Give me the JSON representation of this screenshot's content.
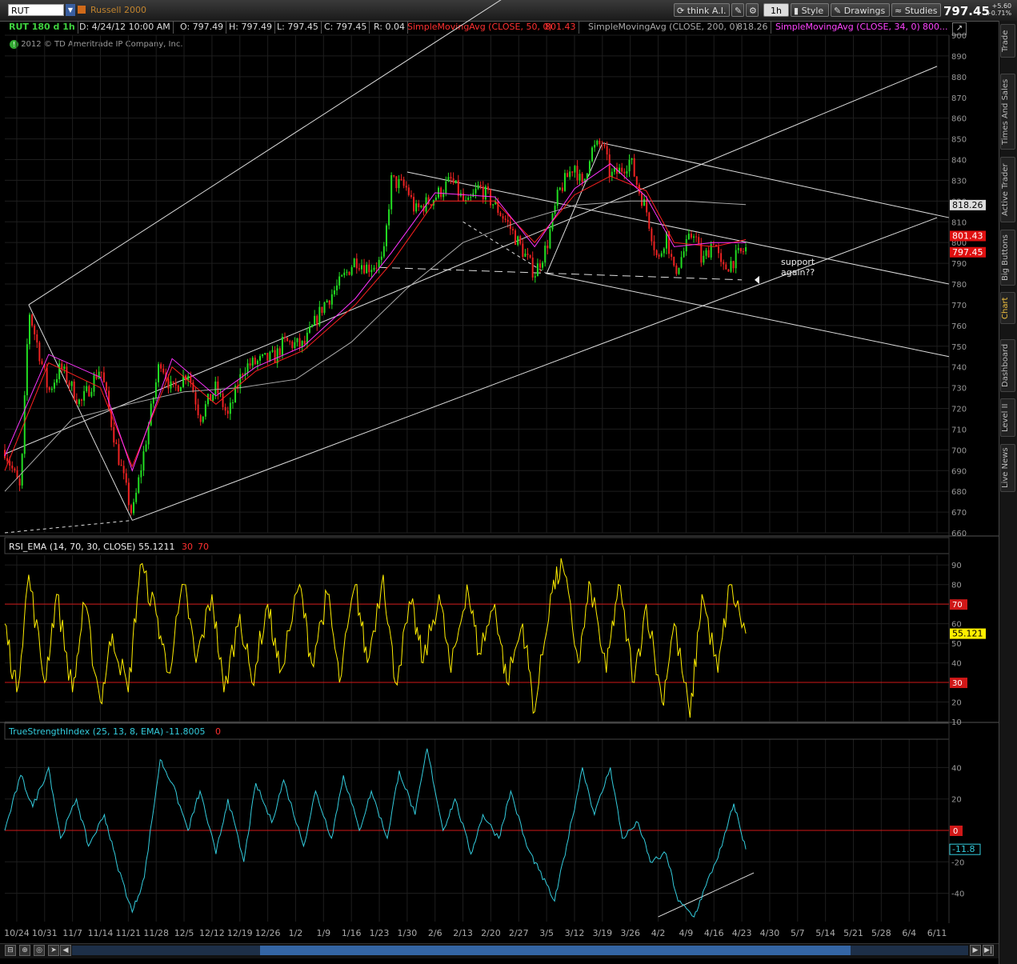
{
  "toolbar": {
    "symbol": "RUT",
    "description": "Russell 2000",
    "think_label": "think A.I.",
    "timeframe": "1h",
    "style_label": "Style",
    "drawings_label": "Drawings",
    "studies_label": "Studies",
    "last_price": "797.45",
    "change": "+5.60",
    "change_pct": "+0.71%"
  },
  "header": {
    "symbol_period": "RUT 180 d 1h",
    "date": "D: 4/24/12 10:00 AM",
    "open": "O: 797.49",
    "high": "H: 797.49",
    "low": "L: 797.45",
    "close": "C: 797.45",
    "range": "R: 0.04",
    "sma50_label": "SimpleMovingAvg (CLOSE, 50, 0)",
    "sma50_value": "801.43",
    "sma200_label": "SimpleMovingAvg (CLOSE, 200, 0)",
    "sma200_value": "818.26",
    "sma34_label": "SimpleMovingAvg (CLOSE, 34, 0)",
    "sma34_value": "800..."
  },
  "watermark": "2012 © TD Ameritrade IP Company, Inc.",
  "annotation": [
    "support",
    "again??"
  ],
  "rsi_header": {
    "label": "RSI_EMA (14, 70, 30, CLOSE)",
    "value": "55.1211",
    "low": "30",
    "high": "70"
  },
  "tsi_header": {
    "label": "TrueStrengthIndex (25, 13, 8, EMA)",
    "value": "-11.8005",
    "zero": "0"
  },
  "side_tabs": [
    "Trade",
    "Times And Sales",
    "Active Trader",
    "Big Buttons",
    "Chart",
    "Dashboard",
    "Level II",
    "Live News"
  ],
  "colors": {
    "up": "#22dd22",
    "down": "#ee2222",
    "sma50": "#ff2020",
    "sma34": "#ff33ff",
    "sma200": "#aaaaaa",
    "rsi": "#ffee00",
    "tsi": "#33ccdd",
    "grid": "#1e1e1e",
    "trend": "#dddddd"
  },
  "chart_data": [
    {
      "type": "line",
      "panel": "price",
      "title": "RUT 180 d 1h",
      "ylim": [
        660,
        900
      ],
      "y_ticks": [
        660,
        670,
        680,
        690,
        700,
        710,
        720,
        730,
        740,
        750,
        760,
        770,
        780,
        790,
        800,
        810,
        820,
        830,
        840,
        850,
        860,
        870,
        880,
        890,
        900
      ],
      "x_tick_labels": [
        "10/24",
        "10/31",
        "11/7",
        "11/14",
        "11/21",
        "11/28",
        "12/5",
        "12/12",
        "12/19",
        "12/26",
        "1/2",
        "1/9",
        "1/16",
        "1/23",
        "1/30",
        "2/6",
        "2/13",
        "2/20",
        "2/27",
        "3/5",
        "3/12",
        "3/19",
        "3/26",
        "4/2",
        "4/9",
        "4/16",
        "4/23",
        "4/30",
        "5/7",
        "5/14",
        "5/21",
        "5/28",
        "6/4",
        "6/11"
      ],
      "price_labels": [
        {
          "value": 818.26,
          "text": "818.26",
          "series": "sma200"
        },
        {
          "value": 801.43,
          "text": "801.43",
          "series": "sma50"
        },
        {
          "value": 797.45,
          "text": "797.45",
          "series": "last"
        }
      ],
      "series": [
        {
          "name": "RUT",
          "x": [
            "10/21",
            "10/25",
            "10/27",
            "11/1",
            "11/4",
            "11/9",
            "11/14",
            "11/18",
            "11/22",
            "11/25",
            "11/29",
            "12/2",
            "12/6",
            "12/9",
            "12/13",
            "12/16",
            "12/20",
            "12/23",
            "12/28",
            "12/30",
            "1/4",
            "1/9",
            "1/13",
            "1/17",
            "1/20",
            "1/24",
            "1/26",
            "1/30",
            "2/1",
            "2/6",
            "2/10",
            "2/14",
            "2/17",
            "2/21",
            "2/24",
            "2/28",
            "3/2",
            "3/5",
            "3/8",
            "3/12",
            "3/14",
            "3/16",
            "3/19",
            "3/21",
            "3/23",
            "3/26",
            "3/28",
            "3/30",
            "4/2",
            "4/4",
            "4/6",
            "4/9",
            "4/11",
            "4/13",
            "4/16",
            "4/18",
            "4/20",
            "4/24"
          ],
          "values": [
            700,
            680,
            768,
            728,
            740,
            722,
            740,
            701,
            668,
            700,
            744,
            728,
            738,
            716,
            730,
            716,
            740,
            742,
            745,
            752,
            750,
            770,
            780,
            792,
            788,
            791,
            830,
            826,
            815,
            822,
            830,
            817,
            827,
            818,
            810,
            796,
            785,
            798,
            824,
            838,
            826,
            844,
            848,
            832,
            834,
            840,
            826,
            816,
            790,
            805,
            785,
            798,
            806,
            790,
            802,
            786,
            790,
            797
          ]
        },
        {
          "name": "SMA 50",
          "x": [
            "10/21",
            "11/1",
            "11/14",
            "11/22",
            "12/2",
            "12/13",
            "12/23",
            "1/4",
            "1/17",
            "1/26",
            "2/6",
            "2/21",
            "3/2",
            "3/12",
            "3/21",
            "3/30",
            "4/6",
            "4/16",
            "4/24"
          ],
          "values": [
            690,
            742,
            730,
            692,
            740,
            722,
            738,
            748,
            770,
            790,
            820,
            820,
            800,
            823,
            832,
            825,
            800,
            798,
            801.43
          ]
        },
        {
          "name": "SMA 34",
          "x": [
            "10/21",
            "11/1",
            "11/14",
            "11/22",
            "12/2",
            "12/13",
            "12/23",
            "1/4",
            "1/17",
            "1/26",
            "2/6",
            "2/21",
            "3/2",
            "3/12",
            "3/21",
            "3/30",
            "4/6",
            "4/16",
            "4/24"
          ],
          "values": [
            697,
            746,
            735,
            690,
            744,
            726,
            740,
            750,
            773,
            795,
            824,
            822,
            798,
            826,
            838,
            822,
            798,
            800,
            800
          ]
        },
        {
          "name": "SMA 200",
          "x": [
            "10/21",
            "11/7",
            "11/21",
            "12/5",
            "12/19",
            "1/2",
            "1/16",
            "1/30",
            "2/13",
            "2/27",
            "3/12",
            "3/26",
            "4/9",
            "4/24"
          ],
          "values": [
            680,
            715,
            722,
            728,
            730,
            734,
            752,
            778,
            800,
            810,
            818,
            820,
            820,
            818.26
          ]
        }
      ]
    },
    {
      "type": "line",
      "panel": "rsi",
      "title": "RSI_EMA (14, 70, 30, CLOSE)",
      "ylim": [
        10,
        95
      ],
      "y_ticks": [
        10,
        20,
        30,
        40,
        50,
        60,
        70,
        80,
        90
      ],
      "reference_lines": [
        30,
        70
      ],
      "current_value": 55.121,
      "series": [
        {
          "name": "RSI_EMA",
          "x": [
            "10/21",
            "10/24",
            "10/27",
            "10/31",
            "11/3",
            "11/7",
            "11/10",
            "11/14",
            "11/17",
            "11/21",
            "11/24",
            "11/28",
            "12/1",
            "12/5",
            "12/8",
            "12/12",
            "12/15",
            "12/19",
            "12/22",
            "12/26",
            "12/29",
            "1/3",
            "1/6",
            "1/10",
            "1/13",
            "1/17",
            "1/20",
            "1/24",
            "1/27",
            "1/31",
            "2/3",
            "2/7",
            "2/10",
            "2/14",
            "2/17",
            "2/21",
            "2/24",
            "2/28",
            "3/2",
            "3/6",
            "3/9",
            "3/13",
            "3/16",
            "3/20",
            "3/23",
            "3/27",
            "3/30",
            "4/3",
            "4/6",
            "4/10",
            "4/13",
            "4/17",
            "4/20",
            "4/24"
          ],
          "values": [
            60,
            25,
            85,
            30,
            75,
            25,
            70,
            20,
            55,
            25,
            90,
            65,
            35,
            80,
            40,
            75,
            25,
            65,
            30,
            70,
            35,
            80,
            40,
            75,
            30,
            80,
            40,
            85,
            30,
            70,
            40,
            75,
            35,
            80,
            45,
            70,
            30,
            60,
            15,
            75,
            90,
            40,
            80,
            35,
            80,
            30,
            70,
            20,
            60,
            12,
            75,
            35,
            80,
            55
          ]
        }
      ]
    },
    {
      "type": "line",
      "panel": "tsi",
      "title": "TrueStrengthIndex (25, 13, 8, EMA)",
      "ylim": [
        -58,
        58
      ],
      "y_ticks": [
        -40,
        -20,
        0,
        20,
        40
      ],
      "reference_lines": [
        0
      ],
      "current_value": -11.8,
      "series": [
        {
          "name": "TSI",
          "x": [
            "10/21",
            "10/25",
            "10/28",
            "11/1",
            "11/4",
            "11/8",
            "11/11",
            "11/15",
            "11/18",
            "11/22",
            "11/25",
            "11/29",
            "12/2",
            "12/6",
            "12/9",
            "12/13",
            "12/16",
            "12/20",
            "12/23",
            "12/27",
            "12/30",
            "1/4",
            "1/7",
            "1/11",
            "1/14",
            "1/18",
            "1/21",
            "1/25",
            "1/28",
            "2/1",
            "2/4",
            "2/8",
            "2/11",
            "2/15",
            "2/18",
            "2/22",
            "2/25",
            "2/29",
            "3/3",
            "3/7",
            "3/10",
            "3/14",
            "3/17",
            "3/21",
            "3/24",
            "3/28",
            "3/31",
            "4/4",
            "4/7",
            "4/11",
            "4/14",
            "4/18",
            "4/21",
            "4/24"
          ],
          "values": [
            0,
            35,
            15,
            40,
            -5,
            20,
            -10,
            10,
            -20,
            -52,
            -30,
            45,
            30,
            0,
            25,
            -15,
            20,
            -20,
            30,
            5,
            32,
            -10,
            25,
            -5,
            35,
            0,
            25,
            -5,
            38,
            10,
            52,
            0,
            20,
            -15,
            10,
            -5,
            25,
            -10,
            -25,
            -45,
            -10,
            40,
            10,
            40,
            -5,
            5,
            -20,
            -15,
            -45,
            -55,
            -35,
            -10,
            17,
            -12
          ]
        }
      ]
    }
  ]
}
